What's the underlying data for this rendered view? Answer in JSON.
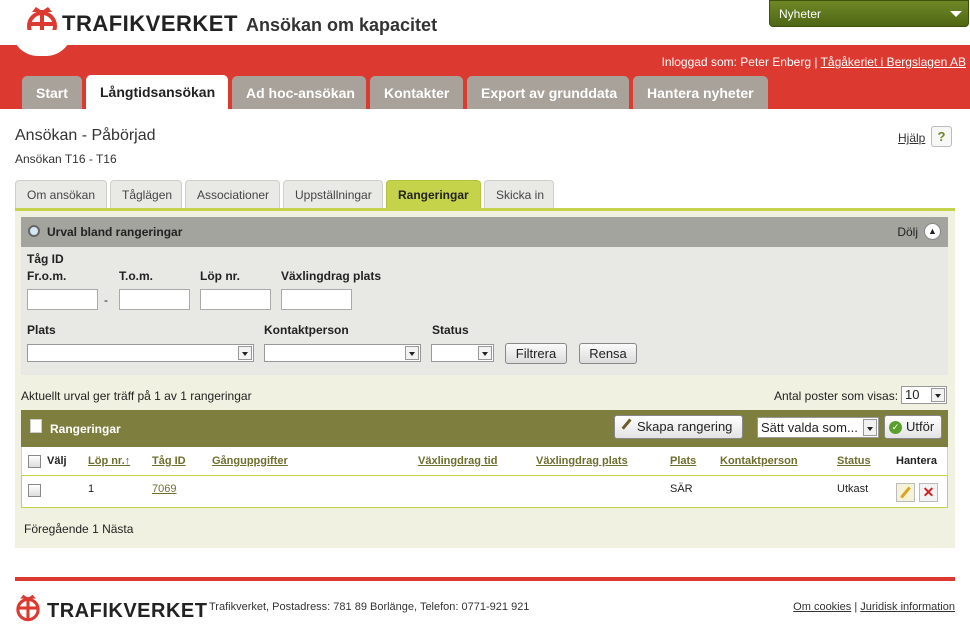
{
  "header": {
    "brand": "TRAFIKVERKET",
    "app_title": "Ansökan om kapacitet",
    "news_label": "Nyheter",
    "logged_in_prefix": "Inloggad som: Peter Enberg |",
    "organization": "Tågåkeriet i Bergslagen AB"
  },
  "main_tabs": [
    "Start",
    "Långtidsansökan",
    "Ad hoc-ansökan",
    "Kontakter",
    "Export av grunddata",
    "Hantera nyheter"
  ],
  "page": {
    "title": "Ansökan - Påbörjad",
    "subtitle": "Ansökan T16 - T16",
    "help": "Hjälp",
    "help_symbol": "?"
  },
  "sub_tabs": [
    "Om ansökan",
    "Tåglägen",
    "Associationer",
    "Uppställningar",
    "Rangeringar",
    "Skicka in"
  ],
  "filter": {
    "title": "Urval bland rangeringar",
    "hide": "Dölj",
    "train_id": "Tåg ID",
    "from": "Fr.o.m.",
    "to": "T.o.m.",
    "dash": "-",
    "run_no": "Löp nr.",
    "switch_place": "Växlingdrag plats",
    "place": "Plats",
    "contact": "Kontaktperson",
    "status": "Status",
    "filter_button": "Filtrera",
    "clear_button": "Rensa"
  },
  "result": {
    "info": "Aktuellt urval ger träff på 1 av 1 rangeringar",
    "per_page_label": "Antal poster som visas:",
    "per_page_value": "10"
  },
  "grid": {
    "title": "Rangeringar",
    "create_button": "Skapa rangering",
    "set_selected": "Sätt valda som...",
    "execute_button": "Utför",
    "columns": [
      "Välj",
      "Löp nr.↑",
      "Tåg ID",
      "Gånguppgifter",
      "Växlingdrag tid",
      "Växlingdrag plats",
      "Plats",
      "Kontaktperson",
      "Status",
      "Hantera"
    ],
    "rows": [
      {
        "lop_nr": "1",
        "tag_id": "7069",
        "gang": "",
        "vx_tid": "",
        "vx_plats": "",
        "plats": "SÄR",
        "kontakt": "",
        "status": "Utkast"
      }
    ]
  },
  "pager": {
    "prev": "Föregående",
    "page": "1",
    "next": "Nästa"
  },
  "footer": {
    "brand": "TRAFIKVERKET",
    "address": "Trafikverket, Postadress: 781 89 Borlänge, Telefon: 0771-921 921",
    "cookies": "Om cookies",
    "separator": "|",
    "legal": "Juridisk information"
  },
  "colors": {
    "brand_red": "#dc3a30",
    "accent_green": "#c5d34b",
    "grid_olive": "#7e7e3e",
    "news_green": "#5f7a1c"
  },
  "icons": [
    "trafikverket-crown-icon",
    "dropdown-arrow-icon",
    "search-icon",
    "collapse-up-icon",
    "document-icon",
    "pencil-icon",
    "check-icon",
    "edit-icon",
    "delete-icon"
  ]
}
